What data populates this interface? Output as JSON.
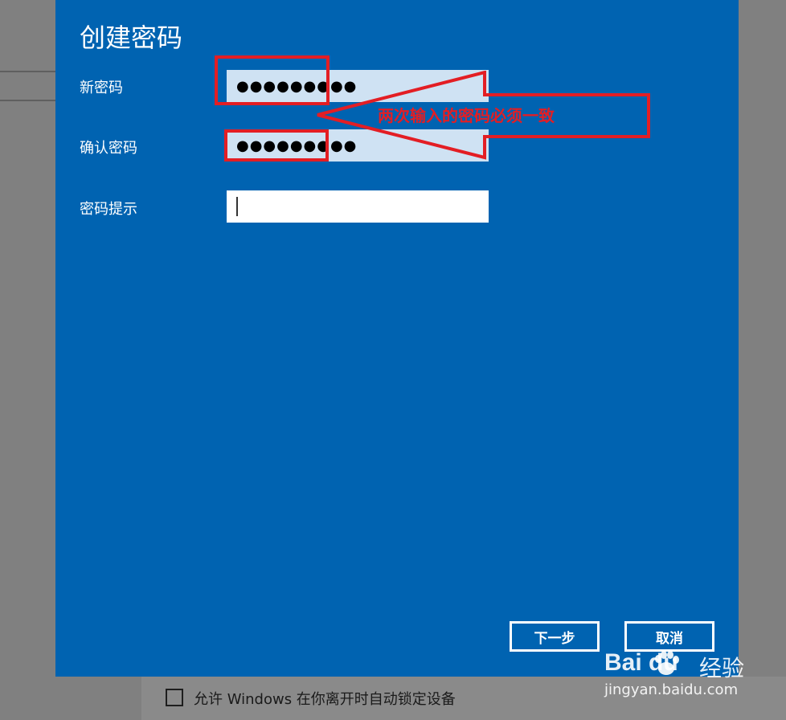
{
  "dialog": {
    "title": "创建密码",
    "fields": [
      {
        "label": "新密码",
        "value": "●●●●●●●●●"
      },
      {
        "label": "确认密码",
        "value": "●●●●●●●●●"
      },
      {
        "label": "密码提示",
        "value": ""
      }
    ],
    "buttons": {
      "next": "下一步",
      "cancel": "取消"
    }
  },
  "background": {
    "checkbox_label": "允许 Windows 在你离开时自动锁定设备"
  },
  "annotation": {
    "text": "两次输入的密码必须一致",
    "color": "#e31e24"
  },
  "watermark": {
    "logo": "Bai du",
    "brand": "经验",
    "url": "jingyan.baidu.com"
  },
  "colors": {
    "dialog_bg": "#0063b1",
    "overlay_bg": "#808080",
    "password_field_bg": "#cfe2f3",
    "highlight": "#e31e24"
  }
}
